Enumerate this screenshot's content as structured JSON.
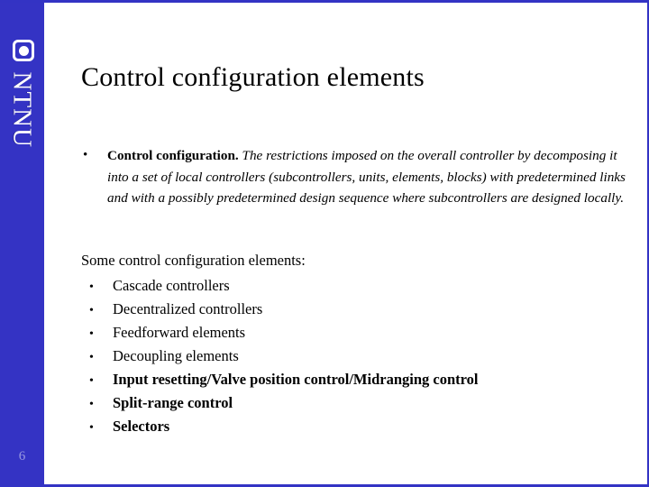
{
  "slide": {
    "page_number": "6",
    "accent_color": "#3333c4",
    "sidebar_color": "#3433c4",
    "page_number_color": "#9a9ae0",
    "text_color": "#000000"
  },
  "branding": {
    "wordmark": "NTNU",
    "logo_icon": "rounded-square-with-dot-icon"
  },
  "header": {
    "title": "Control configuration elements"
  },
  "definition": {
    "bullet_glyph": "•",
    "lead": "Control configuration.",
    "body": " The restrictions imposed on the overall controller  by decomposing it into a set of local controllers (subcontrollers, units, elements, blocks) with predetermined links and with a possibly predetermined design sequence where subcontrollers are designed locally."
  },
  "list": {
    "intro": "Some control configuration elements:",
    "bullet_glyph": "•",
    "items": [
      {
        "label": "Cascade controllers",
        "bold": false
      },
      {
        "label": "Decentralized controllers",
        "bold": false
      },
      {
        "label": "Feedforward elements",
        "bold": false
      },
      {
        "label": "Decoupling elements",
        "bold": false
      },
      {
        "label": "Input resetting/Valve position control/Midranging control",
        "bold": true
      },
      {
        "label": "Split-range control",
        "bold": true
      },
      {
        "label": "Selectors",
        "bold": true
      }
    ]
  }
}
